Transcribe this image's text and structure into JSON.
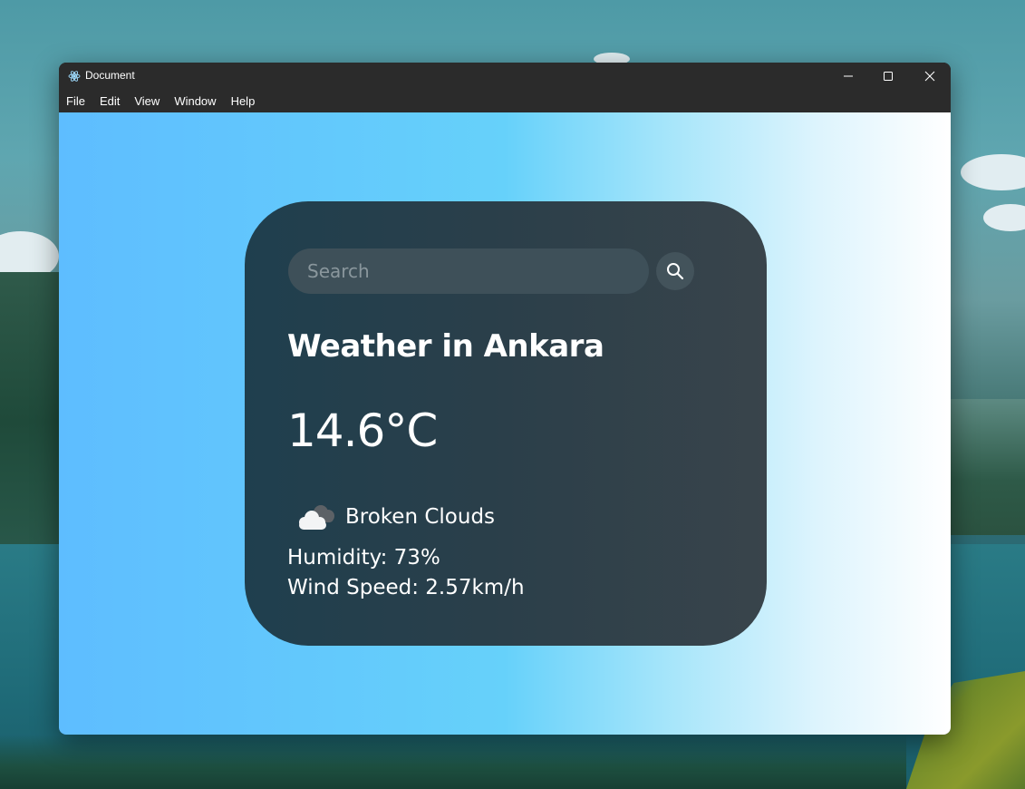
{
  "window": {
    "title": "Document",
    "menu": [
      "File",
      "Edit",
      "View",
      "Window",
      "Help"
    ]
  },
  "weather": {
    "search_placeholder": "Search",
    "city_heading": "Weather in Ankara",
    "temperature": "14.6°C",
    "condition": "Broken Clouds",
    "condition_icon": "broken-clouds-icon",
    "humidity": "Humidity: 73%",
    "wind": "Wind Speed: 2.57km/h"
  },
  "colors": {
    "card_background": "#2b3f4a",
    "gradient_start": "#5ebdff",
    "gradient_end": "#ffffff"
  }
}
